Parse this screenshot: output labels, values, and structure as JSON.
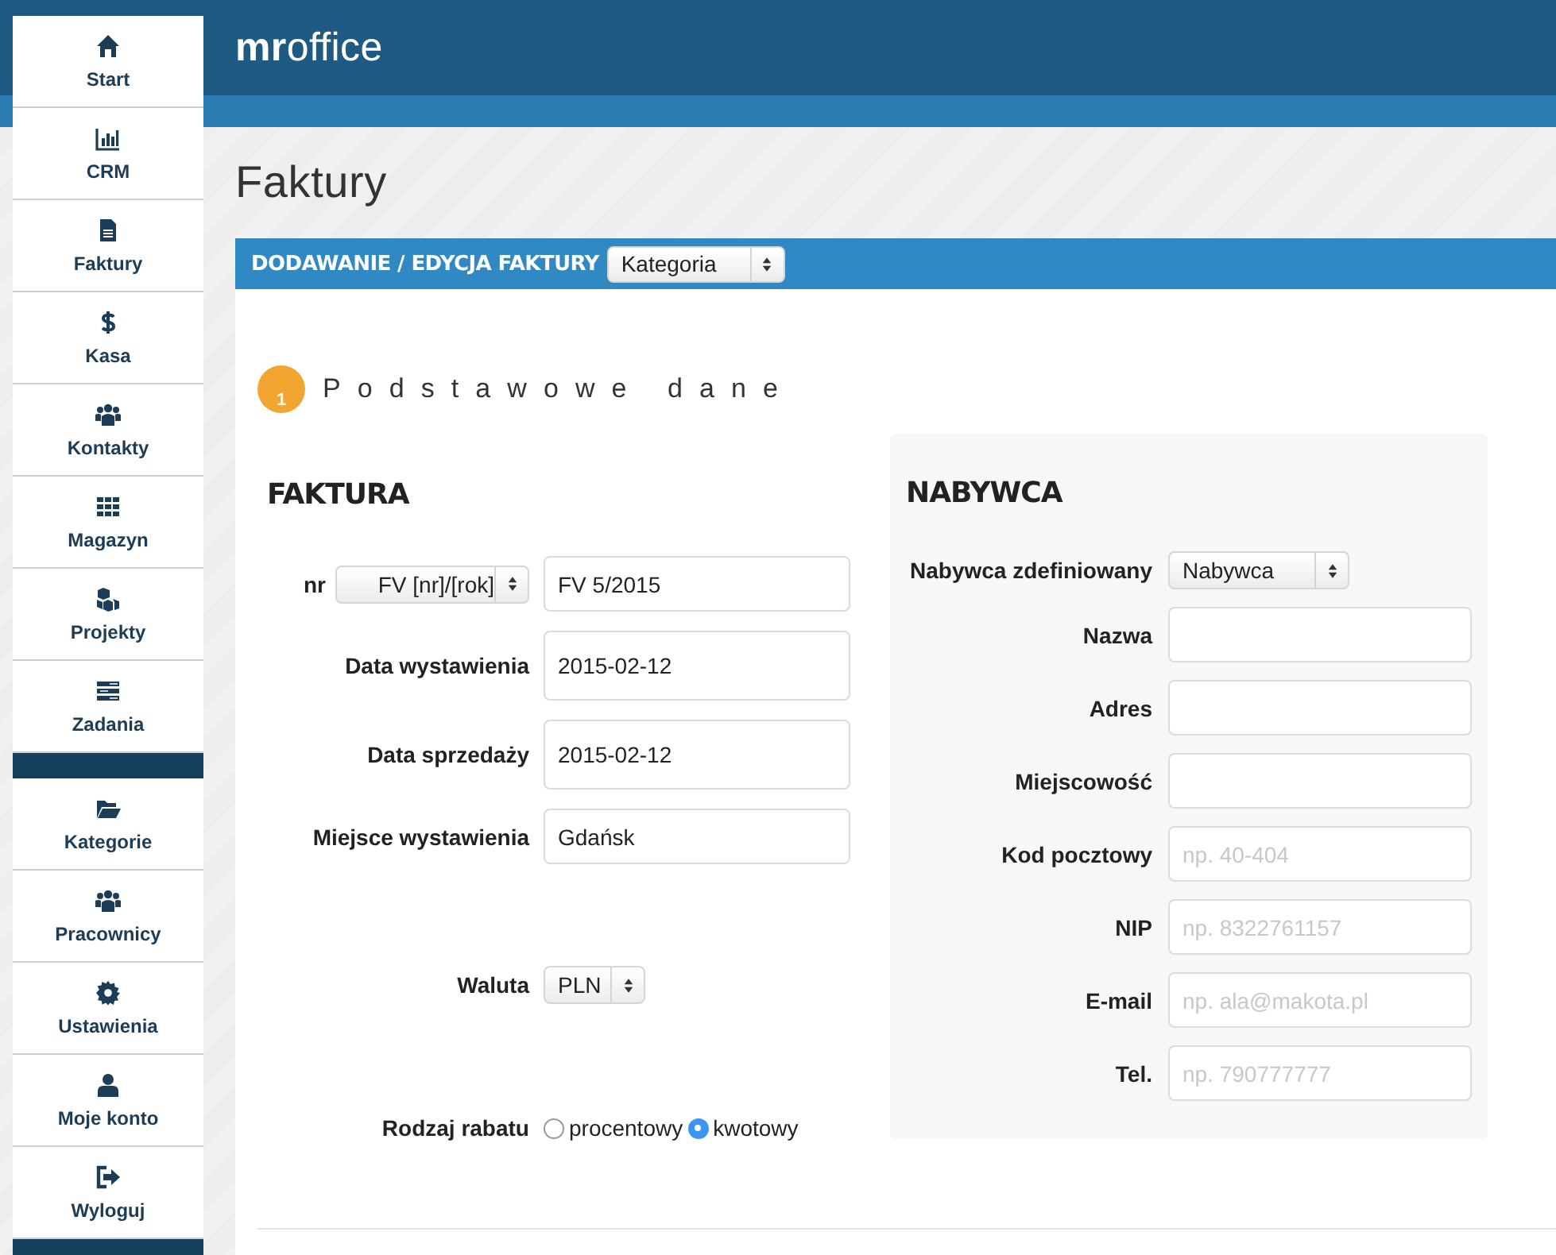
{
  "header": {
    "logo": "**mr**office"
  },
  "sidebar": {
    "sections": [
      {
        "items": [
          {
            "label": "Start"
          },
          {
            "label": "CRM"
          },
          {
            "label": "Faktury"
          },
          {
            "label": "Kasa"
          },
          {
            "label": "Kontakty"
          },
          {
            "label": "Magazyn"
          },
          {
            "label": "Projekty"
          },
          {
            "label": "Zadania"
          }
        ]
      },
      {
        "items": [
          {
            "label": "Kategorie"
          },
          {
            "label": "Pracownicy"
          },
          {
            "label": "Ustawienia"
          },
          {
            "label": "Moje konto"
          },
          {
            "label": "Wyloguj"
          }
        ]
      }
    ]
  },
  "page_title": "Faktury",
  "panel": {
    "title": "DODAWANIE / EDYCJA FAKTURY",
    "category_select": "Kategoria",
    "step": {
      "number": "1",
      "title": "Podstawowe dane"
    },
    "invoice": {
      "heading": "FAKTURA",
      "rows": [
        {
          "kind": "number",
          "label": "nr",
          "select": "FV [nr]/[rok]",
          "value": "FV 5/2015"
        },
        {
          "kind": "input",
          "label": "Data wystawienia",
          "value": "2015-02-12"
        },
        {
          "kind": "input",
          "label": "Data sprzedaży",
          "value": "2015-02-12"
        },
        {
          "kind": "input",
          "label": "Miejsce wystawienia",
          "value": "Gdańsk"
        },
        {
          "kind": "select",
          "label": "Waluta",
          "value": "PLN"
        },
        {
          "kind": "radio",
          "label": "Rodzaj rabatu",
          "options": [
            {
              "label": "procentowy",
              "selected": false
            },
            {
              "label": "kwotowy",
              "selected": true
            }
          ]
        }
      ]
    },
    "buyer": {
      "heading": "NABYWCA",
      "rows": [
        {
          "kind": "select",
          "label": "Nabywca zdefiniowany",
          "value": "Nabywca"
        },
        {
          "kind": "input",
          "label": "Nazwa"
        },
        {
          "kind": "input",
          "label": "Adres"
        },
        {
          "kind": "input",
          "label": "Miejscowość"
        },
        {
          "kind": "input",
          "label": "Kod pocztowy",
          "placeholder": "np. 40-404"
        },
        {
          "kind": "input",
          "label": "NIP",
          "placeholder": "np. 8322761157"
        },
        {
          "kind": "input",
          "label": "E-mail",
          "placeholder": "np. ala@makota.pl"
        },
        {
          "kind": "input",
          "label": "Tel.",
          "placeholder": "np. 790777777"
        }
      ]
    }
  }
}
